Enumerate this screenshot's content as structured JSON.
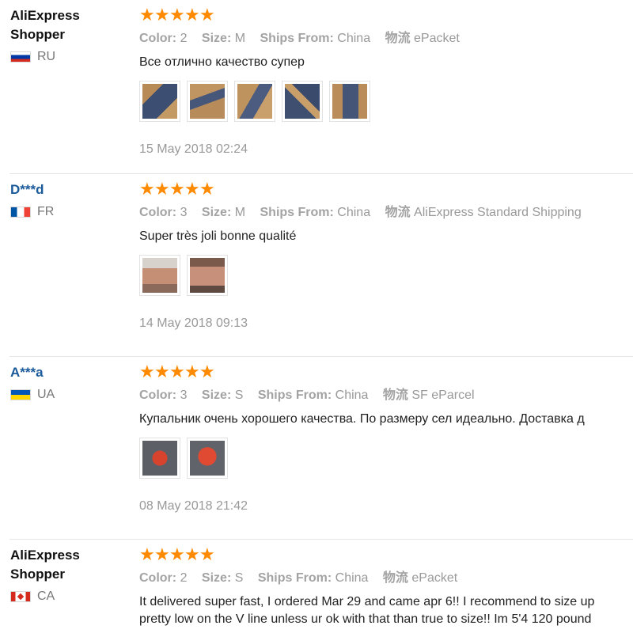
{
  "reviews": [
    {
      "user_name": "AliExpress Shopper",
      "country": "RU",
      "rating": 5,
      "color_label": "Color:",
      "color": "2",
      "size_label": "Size:",
      "size": "M",
      "ships_label": "Ships From:",
      "ships_from": "China",
      "logistics_label": "物流",
      "logistics": "ePacket",
      "text": "Все отлично качество супер",
      "text2": "",
      "photo_count": 5,
      "date": "15 May 2018 02:24"
    },
    {
      "user_name": "D***d",
      "country": "FR",
      "rating": 5,
      "color_label": "Color:",
      "color": "3",
      "size_label": "Size:",
      "size": "M",
      "ships_label": "Ships From:",
      "ships_from": "China",
      "logistics_label": "物流",
      "logistics": "AliExpress Standard Shipping",
      "text": "Super très joli bonne qualité",
      "text2": "",
      "photo_count": 2,
      "date": "14 May 2018 09:13"
    },
    {
      "user_name": "A***a",
      "country": "UA",
      "rating": 5,
      "color_label": "Color:",
      "color": "3",
      "size_label": "Size:",
      "size": "S",
      "ships_label": "Ships From:",
      "ships_from": "China",
      "logistics_label": "物流",
      "logistics": "SF eParcel",
      "text": "Купальник очень хорошего качества. По размеру сел идеально. Доставка д",
      "text2": "",
      "photo_count": 2,
      "date": "08 May 2018 21:42"
    },
    {
      "user_name": "AliExpress Shopper",
      "country": "CA",
      "rating": 5,
      "color_label": "Color:",
      "color": "2",
      "size_label": "Size:",
      "size": "S",
      "ships_label": "Ships From:",
      "ships_from": "China",
      "logistics_label": "物流",
      "logistics": "ePacket",
      "text": "It delivered super fast, I ordered Mar 29 and came apr 6!! I recommend to size up",
      "text2": "pretty low on the V line unless ur ok with that than true to size!! Im 5'4 120 pound",
      "photo_count": 0,
      "date": ""
    }
  ],
  "colors": {
    "star": "#ff8a00",
    "meta_text": "#999999",
    "masked_user": "#1a5a9a"
  },
  "icons": {
    "star": "star-icon",
    "flag": "country-flag-icon"
  }
}
